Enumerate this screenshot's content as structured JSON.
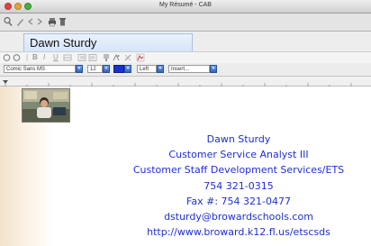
{
  "window": {
    "title": "My Résumé - CAB",
    "controls": {
      "close_color": "#e0443e",
      "minimize_color": "#e2a52b",
      "zoom_color": "#46b23d"
    }
  },
  "toolbar": {
    "icons": [
      "search-icon",
      "back-arrow-icon",
      "forward-arrow-icon",
      "print-icon",
      "trash-icon"
    ]
  },
  "name_tab": {
    "label": "Dawn Sturdy"
  },
  "format_toolbar": {
    "icons": [
      "circle-icon",
      "circle-icon",
      "bold-icon",
      "italic-icon",
      "underline-icon",
      "strikethrough-icon",
      "list-icon",
      "list-icon",
      "paint-icon",
      "script-icon",
      "tools-icon",
      "image-icon"
    ],
    "bold_label": "B",
    "italic_label": "I",
    "underline_label": "U"
  },
  "format_selects": {
    "font": "Comic Sans MS",
    "size": "12",
    "color": "#1a2fd1",
    "align": "Left",
    "insert": "Insert..."
  },
  "document": {
    "accent_color": "#1f2fd6",
    "lines": [
      "Dawn Sturdy",
      "Customer Service Analyst III",
      "Customer Staff Development Services/ETS",
      "754 321-0315",
      "Fax #: 754 321-0477",
      "dsturdy@browardschools.com",
      "http://www.broward.k12.fl.us/etscsds"
    ]
  }
}
